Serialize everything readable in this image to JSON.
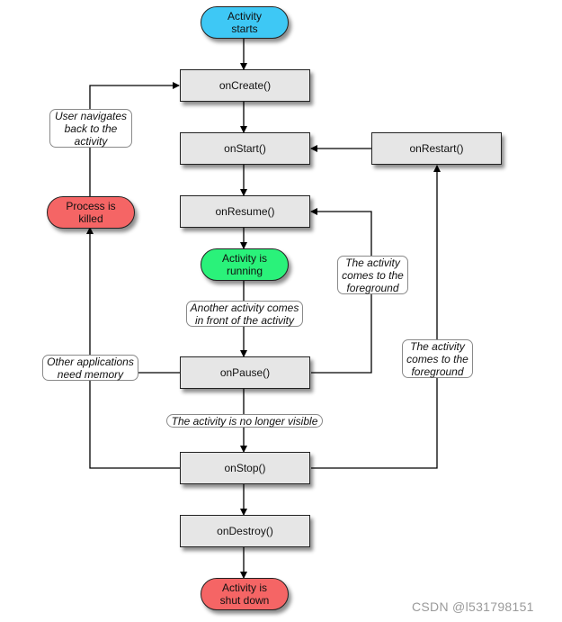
{
  "nodes": {
    "start": {
      "text": "Activity\nstarts",
      "color": "#3ec8f5"
    },
    "on_create": {
      "text": "onCreate()"
    },
    "on_start": {
      "text": "onStart()"
    },
    "on_restart": {
      "text": "onRestart()"
    },
    "on_resume": {
      "text": "onResume()"
    },
    "running": {
      "text": "Activity is\nrunning",
      "color": "#2af27a"
    },
    "on_pause": {
      "text": "onPause()"
    },
    "on_stop": {
      "text": "onStop()"
    },
    "on_destroy": {
      "text": "onDestroy()"
    },
    "killed": {
      "text": "Process is\nkilled",
      "color": "#f56565"
    },
    "shut_down": {
      "text": "Activity is\nshut down",
      "color": "#f56565"
    }
  },
  "edge_labels": {
    "user_navigates": "User navigates\nback to the\nactivity",
    "foreground_resume": "The activity\ncomes to the\nforeground",
    "another_activity": "Another activity comes\nin front of the activity",
    "other_apps": "Other applications\nneed memory",
    "no_longer_visible": "The activity is no longer visible",
    "foreground_restart": "The activity\ncomes to the\nforeground"
  },
  "watermark": "CSDN @l531798151"
}
